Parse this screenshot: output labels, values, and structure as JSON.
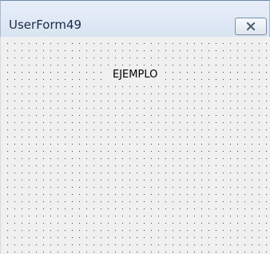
{
  "window": {
    "title": "UserForm49"
  },
  "controls": {
    "label_caption": "EJEMPLO"
  },
  "icons": {
    "close": "close-icon"
  },
  "colors": {
    "titlebar": "#dfe8f5",
    "client_background": "#f0f0f0",
    "grid_dots": "#505050"
  }
}
